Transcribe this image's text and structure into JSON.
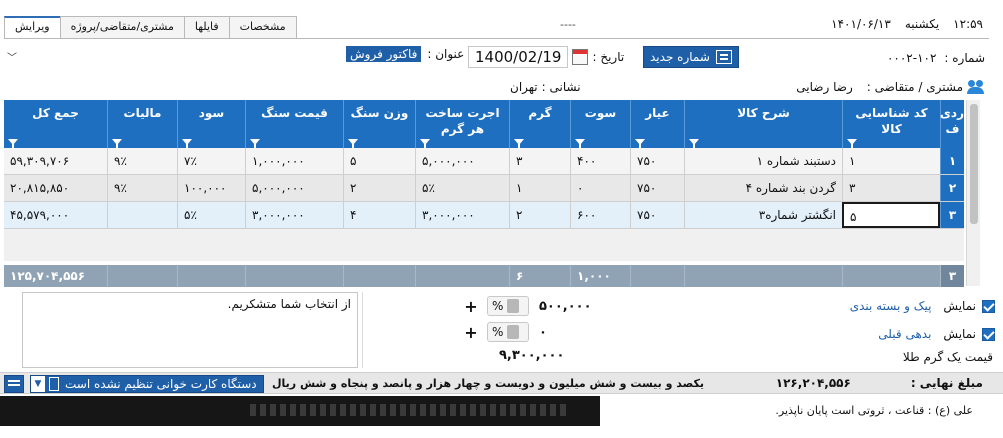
{
  "topbar": {
    "tabs": [
      "ویرایش",
      "مشتری/متقاضی/پروژه",
      "فایلها",
      "مشخصات"
    ],
    "active_tab": 0,
    "dashes": "----",
    "day": "یکشنبه",
    "date": "۱۴۰۱/۰۶/۱۳",
    "time": "۱۲:۵۹"
  },
  "header": {
    "number_label": "شماره :",
    "number_value": "۰۰۰۲-۱۰۲",
    "new_number_button": "شماره جدید",
    "date_label": "تاریخ :",
    "date_value": "1400/02/19",
    "title_label": "عنوان :",
    "title_value": "فاکتور فروش",
    "customer_label": "مشتری / متقاضی :",
    "customer_value": "رضا رضایی",
    "address_label": "نشانی :",
    "address_value": "تهران"
  },
  "grid": {
    "columns": [
      "ردیف",
      "کد شناسایی کالا",
      "شرح کالا",
      "عیار",
      "سوت",
      "گرم",
      "اجرت ساخت هر گرم",
      "وزن سنگ",
      "قیمت سنگ",
      "سود",
      "مالیات",
      "جمع کل"
    ],
    "col_row": "ردی\nف",
    "col_code": "کد شناسایی\nکالا",
    "col_desc": "شرح کالا",
    "col_ayar": "عیار",
    "col_sut": "سوت",
    "col_gram": "گرم",
    "col_ojrat": "اجرت ساخت\nهر گرم",
    "col_vazn": "وزن سنگ",
    "col_gheymat": "قیمت سنگ",
    "col_sood": "سود",
    "col_maliat": "مالیات",
    "col_jam": "جمع کل",
    "rows": [
      {
        "no": "۱",
        "code": "۱",
        "desc": "دستبند شماره ۱",
        "ayar": "۷۵۰",
        "sut": "۴۰۰",
        "gram": "۳",
        "ojrat": "۵,۰۰۰,۰۰۰",
        "vazn": "۵",
        "gheymat": "۱,۰۰۰,۰۰۰",
        "sood": "۷٪",
        "maliat": "۹٪",
        "jam": "۵۹,۳۰۹,۷۰۶"
      },
      {
        "no": "۲",
        "code": "۳",
        "desc": "گردن بند شماره ۴",
        "ayar": "۷۵۰",
        "sut": "۰",
        "gram": "۱",
        "ojrat": "۵٪",
        "vazn": "۲",
        "gheymat": "۵,۰۰۰,۰۰۰",
        "sood": "۱۰۰,۰۰۰",
        "maliat": "۹٪",
        "jam": "۲۰,۸۱۵,۸۵۰"
      },
      {
        "no": "۳",
        "code": "۵",
        "desc": "انگشتر شماره۳",
        "ayar": "۷۵۰",
        "sut": "۶۰۰",
        "gram": "۲",
        "ojrat": "۳,۰۰۰,۰۰۰",
        "vazn": "۴",
        "gheymat": "۳,۰۰۰,۰۰۰",
        "sood": "۵٪",
        "maliat": "",
        "jam": "۴۵,۵۷۹,۰۰۰"
      }
    ],
    "totals": {
      "no": "۳",
      "sut": "۱,۰۰۰",
      "gram": "۶",
      "jam": "۱۲۵,۷۰۴,۵۵۶"
    }
  },
  "notes": {
    "text": "از انتخاب شما متشکریم."
  },
  "amounts": {
    "pct_symbol": "%",
    "packaging_amount": "۵۰۰,۰۰۰",
    "prev_debt_amount": "۰",
    "gold_price_value": "۹,۳۰۰,۰۰۰"
  },
  "options": {
    "show_label": "نمایش",
    "packaging_link": "پیک و بسته بندی",
    "prev_debt_link": "بدهی قبلی",
    "gold_price_label": "قیمت یک گرم طلا"
  },
  "statusbar": {
    "final_label": "مبلغ نهایی :",
    "final_value": "۱۲۶,۲۰۴,۵۵۶",
    "amount_words": "یکصد و بیست و شش میلیون و دویست و  چهار هزار و پانصد و پنجاه و شش ریال",
    "device_text": "دستگاه کارت خوانی تنظیم نشده است"
  },
  "footer": {
    "quote": "علی (ع) : قناعت ، ثروتی است پایان ناپذیر."
  }
}
